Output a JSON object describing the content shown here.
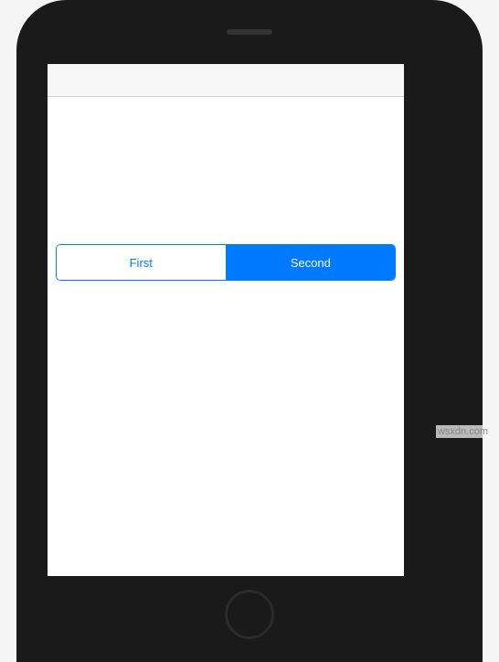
{
  "segmented": {
    "segments": [
      {
        "label": "First",
        "selected": false
      },
      {
        "label": "Second",
        "selected": true
      }
    ]
  },
  "colors": {
    "accent": "#007aff"
  },
  "watermark": "wsxdn.com"
}
